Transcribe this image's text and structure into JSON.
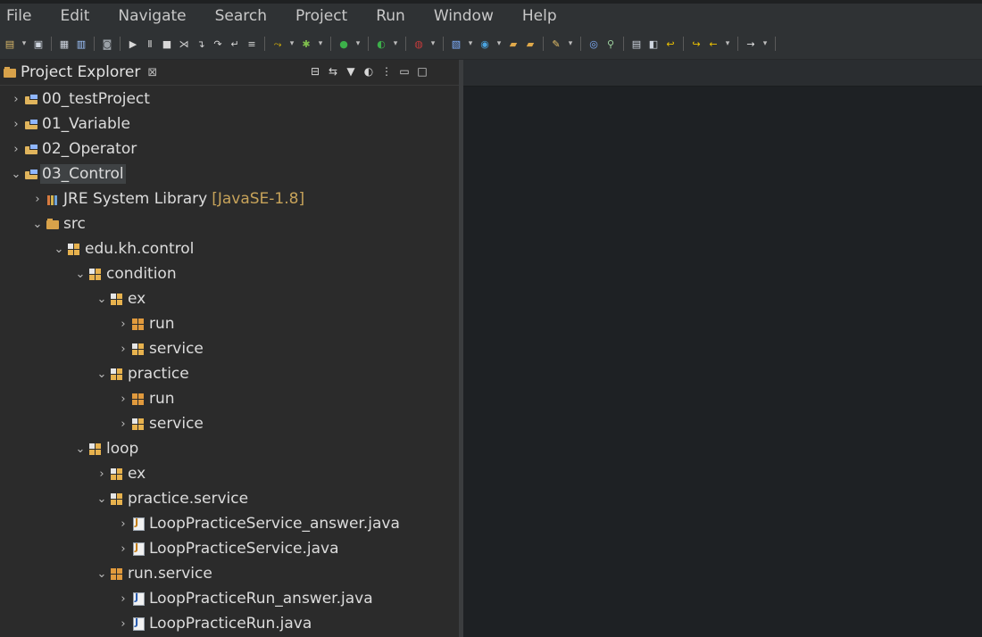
{
  "menu": [
    "File",
    "Edit",
    "Navigate",
    "Search",
    "Project",
    "Run",
    "Window",
    "Help"
  ],
  "toolbar": {
    "buttons": [
      {
        "name": "new-wizard-icon",
        "glyph": "▤",
        "color": "#d9b86a"
      },
      {
        "name": "save-icon",
        "glyph": "▣",
        "color": "#cfd6e0"
      },
      {
        "name": "save-all-icon",
        "glyph": "▦",
        "color": "#cfd6e0"
      },
      {
        "name": "print-icon",
        "glyph": "▥",
        "color": "#9fc6ff"
      },
      {
        "name": "open-type-icon",
        "glyph": "◙",
        "color": "#9aa0a6"
      },
      {
        "name": "resume-icon",
        "glyph": "▶",
        "color": "#d8d8d8"
      },
      {
        "name": "suspend-icon",
        "glyph": "Ⅱ",
        "color": "#d8d8d8"
      },
      {
        "name": "terminate-icon",
        "glyph": "■",
        "color": "#d8d8d8"
      },
      {
        "name": "disconnect-icon",
        "glyph": "⋊",
        "color": "#d8d8d8"
      },
      {
        "name": "step-into-icon",
        "glyph": "↴",
        "color": "#d8d8d8"
      },
      {
        "name": "step-over-icon",
        "glyph": "↷",
        "color": "#d8d8d8"
      },
      {
        "name": "step-return-icon",
        "glyph": "↵",
        "color": "#d8d8d8"
      },
      {
        "name": "use-step-filters-icon",
        "glyph": "≡",
        "color": "#d8d8d8"
      },
      {
        "name": "skip-breakpoints-icon",
        "glyph": "⤳",
        "color": "#f0c400"
      },
      {
        "name": "debug-icon",
        "glyph": "✱",
        "color": "#7fbf4d"
      },
      {
        "name": "run-icon",
        "glyph": "●",
        "color": "#3cb04a"
      },
      {
        "name": "coverage-icon",
        "glyph": "◐",
        "color": "#3cb04a"
      },
      {
        "name": "external-tools-icon",
        "glyph": "◍",
        "color": "#c43b3b"
      },
      {
        "name": "new-java-project-icon",
        "glyph": "▧",
        "color": "#7fb0ff"
      },
      {
        "name": "new-java-class-icon",
        "glyph": "◉",
        "color": "#4aa3df"
      },
      {
        "name": "open-folder-icon",
        "glyph": "▰",
        "color": "#e0a94a"
      },
      {
        "name": "open-project-icon",
        "glyph": "▰",
        "color": "#e0a94a"
      },
      {
        "name": "pen-icon",
        "glyph": "✎",
        "color": "#e8c36a"
      },
      {
        "name": "globe-icon",
        "glyph": "◎",
        "color": "#7fb0ff"
      },
      {
        "name": "search-java-icon",
        "glyph": "⚲",
        "color": "#9fd39f"
      },
      {
        "name": "annotation-icon",
        "glyph": "▤",
        "color": "#cfd6e0"
      },
      {
        "name": "last-edit-icon",
        "glyph": "◧",
        "color": "#cfd6e0"
      },
      {
        "name": "prev-annotation-icon",
        "glyph": "↩",
        "color": "#f0c400"
      },
      {
        "name": "next-annotation-icon",
        "glyph": "↪",
        "color": "#f0c400"
      },
      {
        "name": "back-icon",
        "glyph": "←",
        "color": "#f0c400"
      },
      {
        "name": "forward-icon",
        "glyph": "→",
        "color": "#e6e6e6"
      }
    ]
  },
  "explorer": {
    "title": "Project Explorer",
    "close_glyph": "⊠",
    "actions": [
      {
        "name": "collapse-all-icon",
        "glyph": "⊟"
      },
      {
        "name": "link-with-editor-icon",
        "glyph": "⇆"
      },
      {
        "name": "filter-icon",
        "glyph": "▼"
      },
      {
        "name": "focus-icon",
        "glyph": "◐"
      },
      {
        "name": "view-menu-icon",
        "glyph": "⋮"
      },
      {
        "name": "minimize-icon",
        "glyph": "▭"
      },
      {
        "name": "maximize-icon",
        "glyph": "□"
      }
    ],
    "tree": [
      {
        "label": "00_testProject",
        "decor": "",
        "expanded": false,
        "selected": false,
        "icon": "project",
        "twisty": "›"
      },
      {
        "label": "01_Variable",
        "decor": "",
        "expanded": false,
        "selected": false,
        "icon": "project",
        "twisty": "›"
      },
      {
        "label": "02_Operator",
        "decor": "",
        "expanded": false,
        "selected": false,
        "icon": "project",
        "twisty": "›"
      },
      {
        "label": "03_Control",
        "decor": "",
        "expanded": true,
        "selected": true,
        "icon": "project",
        "twisty": "⌄"
      },
      {
        "label": "JRE System Library",
        "decor": "[JavaSE-1.8]",
        "expanded": false,
        "selected": false,
        "icon": "library",
        "twisty": "›"
      },
      {
        "label": "src",
        "decor": "",
        "expanded": true,
        "selected": false,
        "icon": "folder",
        "twisty": "⌄"
      },
      {
        "label": "edu.kh.control",
        "decor": "",
        "expanded": true,
        "selected": false,
        "icon": "package",
        "twisty": "⌄"
      },
      {
        "label": "condition",
        "decor": "",
        "expanded": true,
        "selected": false,
        "icon": "package",
        "twisty": "⌄"
      },
      {
        "label": "ex",
        "decor": "",
        "expanded": true,
        "selected": false,
        "icon": "package",
        "twisty": "⌄"
      },
      {
        "label": "run",
        "decor": "",
        "expanded": false,
        "selected": false,
        "icon": "package-plain",
        "twisty": "›"
      },
      {
        "label": "service",
        "decor": "",
        "expanded": false,
        "selected": false,
        "icon": "package",
        "twisty": "›"
      },
      {
        "label": "practice",
        "decor": "",
        "expanded": true,
        "selected": false,
        "icon": "package",
        "twisty": "⌄"
      },
      {
        "label": "run",
        "decor": "",
        "expanded": false,
        "selected": false,
        "icon": "package-plain",
        "twisty": "›"
      },
      {
        "label": "service",
        "decor": "",
        "expanded": false,
        "selected": false,
        "icon": "package",
        "twisty": "›"
      },
      {
        "label": "loop",
        "decor": "",
        "expanded": true,
        "selected": false,
        "icon": "package",
        "twisty": "⌄"
      },
      {
        "label": "ex",
        "decor": "",
        "expanded": false,
        "selected": false,
        "icon": "package",
        "twisty": "›"
      },
      {
        "label": "practice.service",
        "decor": "",
        "expanded": true,
        "selected": false,
        "icon": "package",
        "twisty": "⌄"
      },
      {
        "label": "LoopPracticeService_answer.java",
        "decor": "",
        "expanded": false,
        "selected": false,
        "icon": "java-answer",
        "twisty": "›"
      },
      {
        "label": "LoopPracticeService.java",
        "decor": "",
        "expanded": false,
        "selected": false,
        "icon": "java-answer",
        "twisty": "›"
      },
      {
        "label": "run.service",
        "decor": "",
        "expanded": true,
        "selected": false,
        "icon": "package-plain",
        "twisty": "⌄"
      },
      {
        "label": "LoopPracticeRun_answer.java",
        "decor": "",
        "expanded": false,
        "selected": false,
        "icon": "java",
        "twisty": "›"
      },
      {
        "label": "LoopPracticeRun.java",
        "decor": "",
        "expanded": false,
        "selected": false,
        "icon": "java",
        "twisty": "›"
      }
    ]
  }
}
